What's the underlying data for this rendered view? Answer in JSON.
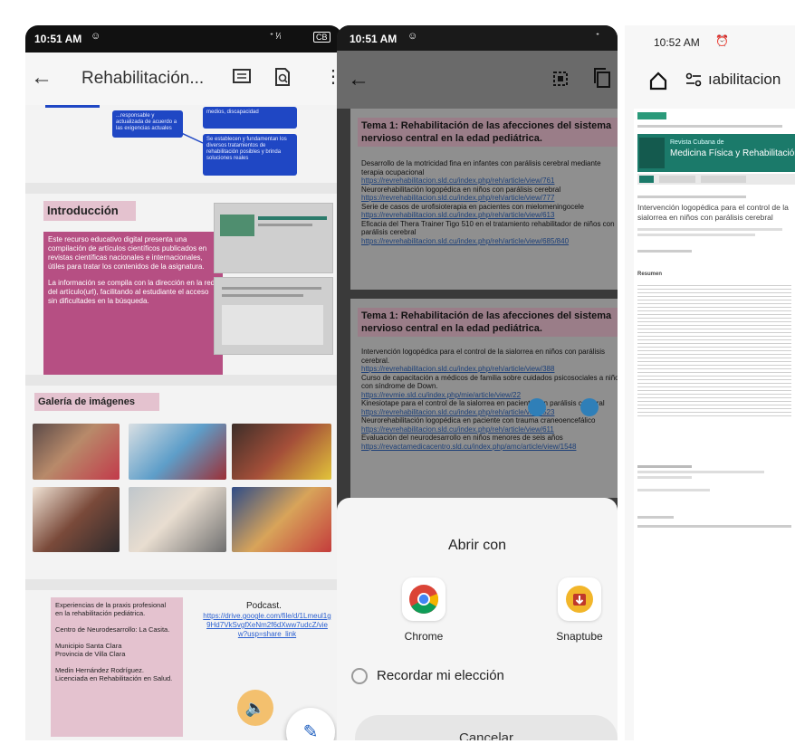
{
  "phone1": {
    "status_time": "10:51 AM",
    "status_right": "ᐩ ᵗ⁄ₗ",
    "battery": "CB",
    "title": "Rehabilitación...",
    "blue_boxes": {
      "left": "...responsable y actualizada de acuerdo a las exigencias actuales",
      "right_top": "medios, discapacidad",
      "right_bottom": "Se establecen y fundamentan los diversos tratamientos de rehabilitación posibles y brinda soluciones reales"
    },
    "intro": {
      "heading": "Introducción",
      "para1": "Este recurso educativo digital presenta una compilación de artículos científicos publicados en revistas científicas nacionales e internacionales, útiles para tratar los contenidos de la asignatura.",
      "para2": "La información se compila con la dirección en la red del artículo(url), facilitando al estudiante el acceso sin dificultades en la búsqueda."
    },
    "gallery": {
      "heading": "Galería de imágenes"
    },
    "bottom": {
      "experiences": "Experiencias de la praxis profesional\nen la rehabilitación pediátrica.\n\nCentro de Neurodesarrollo: La Casita.\n\nMunicipio Santa Clara\nProvincia de Villa Clara\n\nMedin Hernández Rodríguez.\nLicenciada en Rehabilitación en Salud.",
      "podcast_label": "Podcast.",
      "podcast_link": "https://drive.google.com/file/d/1Lmeul1g9Hd7VkSvgfXeNm2f6dXww7udcZ/view?usp=share_link"
    }
  },
  "phone2": {
    "status_time": "10:51 AM",
    "block1": {
      "title": "Tema 1: Rehabilitación de las afecciones del sistema nervioso central en la edad pediátrica.",
      "lines": [
        {
          "text": "Desarrollo de la motricidad fina en infantes con parálisis cerebral mediante terapia ocupacional",
          "link": "https://revrehabilitacion.sld.cu/index.php/reh/article/view/761"
        },
        {
          "text": "Neurorehabilitación logopédica en niños con parálisis cerebral",
          "link": "https://revrehabilitacion.sld.cu/index.php/reh/article/view/777"
        },
        {
          "text": "Serie de casos de urofisioterapia en pacientes con mielomeningocele",
          "link": "https://revrehabilitacion.sld.cu/index.php/reh/article/view/613"
        },
        {
          "text": "Eficacia del Thera Trainer Tigo 510 en el tratamiento rehabilitador de niños con parálisis cerebral",
          "link": "https://revrehabilitacion.sld.cu/index.php/reh/article/view/685/840"
        }
      ]
    },
    "block2": {
      "title": "Tema 1: Rehabilitación de las afecciones del sistema nervioso central en la edad pediátrica.",
      "lines": [
        {
          "text": "Intervención logopédica para el control de la sialorrea en niños con parálisis cerebral.",
          "link": "https://revrehabilitacion.sld.cu/index.php/reh/article/view/388"
        },
        {
          "text": "Curso de capacitación a médicos de familia sobre cuidados psicosociales a niños con síndrome de Down.",
          "link": "https://revmie.sld.cu/index.php/mie/article/view/22"
        },
        {
          "text": "Kinesiotape para el control de la sialorrea en paciente con parálisis cerebral",
          "link": "https://revrehabilitacion.sld.cu/index.php/reh/article/view/523"
        },
        {
          "text": "Neurorehabilitación logopédica en paciente con trauma craneoencefálico",
          "link": "https://revrehabilitacion.sld.cu/index.php/reh/article/view/611"
        },
        {
          "text": "Evaluación del neurodesarrollo en niños menores de seis años",
          "link": "https://revactamedicacentro.sld.cu/index.php/amc/article/view/1548"
        }
      ]
    },
    "sheet": {
      "title": "Abrir con",
      "apps": [
        {
          "label": "Chrome",
          "icon": "chrome-icon"
        },
        {
          "label": "Snaptube",
          "icon": "snaptube-icon"
        }
      ],
      "remember": "Recordar mi elección",
      "cancel": "Cancelar"
    }
  },
  "phone3": {
    "status_time": "10:52 AM",
    "url_text": "ıabilitacion",
    "journal_title_line1": "Revista Cubana de",
    "journal_title_line2": "Medicina Física y Rehabilitación",
    "article_title": "Intervención logopédica para el control de la sialorrea en niños con parálisis cerebral",
    "section_heading": "Resumen"
  },
  "colors": {
    "pink_box": "#b64f83",
    "pink_label": "#e4c2cf",
    "blue_box": "#1f47c4",
    "journal_green": "#1b7a6a"
  }
}
